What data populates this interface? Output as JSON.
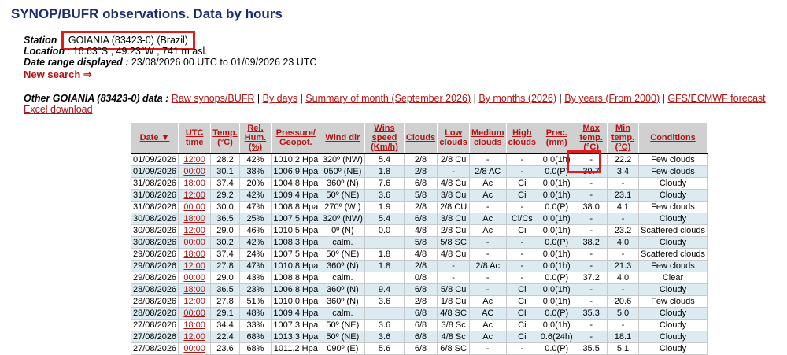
{
  "page": {
    "title": "SYNOP/BUFR observations. Data by hours"
  },
  "station": {
    "station_label": "Station",
    "station_value": "GOIANIA (83423-0) (Brazil)",
    "location_label": "Location",
    "location_value": ": 16.63°S , 49.23°W , 741 m asl.",
    "range_label": "Date range displayed :",
    "range_value": "23/08/2026 00 UTC to 01/09/2026 23 UTC",
    "new_search": "New search ⇒"
  },
  "other": {
    "label": "Other GOIANIA (83423-0) data :",
    "links": [
      "Raw synops/BUFR",
      "By days",
      "Summary of month (September 2026)",
      "By months (2026)",
      "By years (From 2000)",
      "GFS/ECMWF forecast",
      "Excel download"
    ],
    "separator": "|"
  },
  "table": {
    "headers": [
      "Date ▼",
      "UTC time",
      "Temp. (°C)",
      "Rel. Hum. (%)",
      "Pressure/ Geopot.",
      "Wind dir",
      "Wins speed (Km/h)",
      "Clouds",
      "Low clouds",
      "Medium clouds",
      "High clouds",
      "Prec. (mm)",
      "Max temp. (°C)",
      "Min temp. (°C)",
      "Conditions"
    ],
    "rows": [
      [
        "01/09/2026",
        "12:00",
        "28.2",
        "42%",
        "1010.2 Hpa",
        "320º (NW)",
        "5.4",
        "2/8",
        "2/8 Cu",
        "-",
        "-",
        "0.0(1h)",
        "-",
        "22.2",
        "Few clouds"
      ],
      [
        "01/09/2026",
        "00:00",
        "30.1",
        "38%",
        "1006.9 Hpa",
        "050º (NE)",
        "1.8",
        "2/8",
        "-",
        "2/8 AC",
        "-",
        "0.0(P)",
        "39.7",
        "3.4",
        "Few clouds"
      ],
      [
        "31/08/2026",
        "18:00",
        "37.4",
        "20%",
        "1004.8 Hpa",
        "360º (N)",
        "7.6",
        "6/8",
        "4/8 Cu",
        "Ac",
        "Ci",
        "0.0(1h)",
        "-",
        "-",
        "Cloudy"
      ],
      [
        "31/08/2026",
        "12:00",
        "29.2",
        "42%",
        "1009.4 Hpa",
        "50º (NE)",
        "3.6",
        "5/8",
        "3/8 Cu",
        "Ac",
        "Ci",
        "0.0(1h)",
        "-",
        "23.1",
        "Cloudy"
      ],
      [
        "31/08/2026",
        "00:00",
        "30.0",
        "47%",
        "1008.8 Hpa",
        "270º (W )",
        "1.9",
        "2/8",
        "2/8 CU",
        "-",
        "-",
        "0.0(P)",
        "38.0",
        "4.1",
        "Few clouds"
      ],
      [
        "30/08/2026",
        "18:00",
        "36.5",
        "25%",
        "1007.5 Hpa",
        "320º (NW)",
        "5.4",
        "6/8",
        "3/8 Cu",
        "Ac",
        "Ci/Cs",
        "0.0(1h)",
        "-",
        "-",
        "Cloudy"
      ],
      [
        "30/08/2026",
        "12:00",
        "29.0",
        "46%",
        "1010.5 Hpa",
        "0º (N)",
        "0.0",
        "4/8",
        "2/8 Cu",
        "Ac",
        "Ci",
        "0.0(1h)",
        "-",
        "23.2",
        "Scattered clouds"
      ],
      [
        "30/08/2026",
        "00:00",
        "30.2",
        "42%",
        "1008.3 Hpa",
        "calm.",
        "",
        "5/8",
        "5/8 SC",
        "-",
        "-",
        "0.0(P)",
        "38.2",
        "4.0",
        "Cloudy"
      ],
      [
        "29/08/2026",
        "18:00",
        "37.4",
        "24%",
        "1007.5 Hpa",
        "50º (NE)",
        "1.8",
        "4/8",
        "4/8 Cu",
        "-",
        "-",
        "0.0(1h)",
        "-",
        "-",
        "Scattered clouds"
      ],
      [
        "29/08/2026",
        "12:00",
        "27.8",
        "47%",
        "1010.8 Hpa",
        "360º (N)",
        "1.8",
        "2/8",
        "-",
        "2/8 Ac",
        "-",
        "0.0(1h)",
        "-",
        "21.3",
        "Few clouds"
      ],
      [
        "29/08/2026",
        "00:00",
        "29.0",
        "43%",
        "1008.8 Hpa",
        "calm.",
        "",
        "0/8",
        "-",
        "-",
        "-",
        "0.0(P)",
        "37.2",
        "4.0",
        "Clear"
      ],
      [
        "28/08/2026",
        "18:00",
        "36.5",
        "23%",
        "1006.8 Hpa",
        "360º (N)",
        "9.4",
        "6/8",
        "5/8 Cu",
        "-",
        "Ci",
        "0.0(1h)",
        "-",
        "-",
        "Cloudy"
      ],
      [
        "28/08/2026",
        "12:00",
        "27.8",
        "51%",
        "1010.0 Hpa",
        "360º (N)",
        "3.6",
        "2/8",
        "1/8 Cu",
        "Ac",
        "Ci",
        "0.0(1h)",
        "-",
        "20.6",
        "Few clouds"
      ],
      [
        "28/08/2026",
        "00:00",
        "29.1",
        "48%",
        "1009.4 Hpa",
        "calm.",
        "",
        "6/8",
        "4/8 SC",
        "AC",
        "CI",
        "0.0(P)",
        "35.3",
        "5.0",
        "Cloudy"
      ],
      [
        "27/08/2026",
        "18:00",
        "34.4",
        "33%",
        "1007.3 Hpa",
        "50º (NE)",
        "3.6",
        "6/8",
        "3/8 Sc",
        "Ac",
        "Ci",
        "0.0(1h)",
        "-",
        "-",
        "Cloudy"
      ],
      [
        "27/08/2026",
        "12:00",
        "22.4",
        "68%",
        "1013.3 Hpa",
        "50º (NE)",
        "3.6",
        "6/8",
        "4/8 Sc",
        "Ac",
        "Ci",
        "0.6(24h)",
        "-",
        "18.1",
        "Cloudy"
      ],
      [
        "27/08/2026",
        "00:00",
        "23.6",
        "68%",
        "1011.2 Hpa",
        "090º (E)",
        "5.6",
        "6/8",
        "6/8 SC",
        "-",
        "-",
        "0.0(P)",
        "35.5",
        "5.1",
        "Cloudy"
      ]
    ]
  }
}
